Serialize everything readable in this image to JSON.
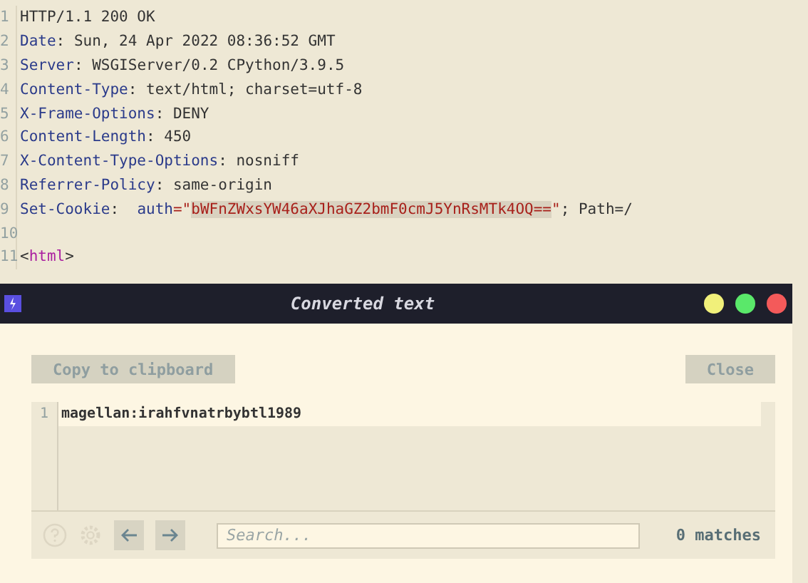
{
  "editor": {
    "lines": [
      {
        "number": "1",
        "segments": [
          {
            "text": "HTTP/1.1 200 OK",
            "kind": "plain"
          }
        ]
      },
      {
        "number": "2",
        "segments": [
          {
            "text": "Date",
            "kind": "key"
          },
          {
            "text": ": Sun, 24 Apr 2022 08:36:52 GMT",
            "kind": "plain"
          }
        ]
      },
      {
        "number": "3",
        "segments": [
          {
            "text": "Server",
            "kind": "key"
          },
          {
            "text": ": WSGIServer/0.2 CPython/3.9.5",
            "kind": "plain"
          }
        ]
      },
      {
        "number": "4",
        "segments": [
          {
            "text": "Content-Type",
            "kind": "key"
          },
          {
            "text": ": text/html; charset=utf-8",
            "kind": "plain"
          }
        ]
      },
      {
        "number": "5",
        "segments": [
          {
            "text": "X-Frame-Options",
            "kind": "key"
          },
          {
            "text": ": DENY",
            "kind": "plain"
          }
        ]
      },
      {
        "number": "6",
        "segments": [
          {
            "text": "Content-Length",
            "kind": "key"
          },
          {
            "text": ": 450",
            "kind": "plain"
          }
        ]
      },
      {
        "number": "7",
        "segments": [
          {
            "text": "X-Content-Type-Options",
            "kind": "key"
          },
          {
            "text": ": nosniff",
            "kind": "plain"
          }
        ]
      },
      {
        "number": "8",
        "segments": [
          {
            "text": "Referrer-Policy",
            "kind": "key"
          },
          {
            "text": ": same-origin",
            "kind": "plain"
          }
        ]
      },
      {
        "number": "9",
        "segments": [
          {
            "text": "Set-Cookie",
            "kind": "key"
          },
          {
            "text": ":  ",
            "kind": "plain"
          },
          {
            "text": "auth",
            "kind": "key"
          },
          {
            "text": "=\"",
            "kind": "string"
          },
          {
            "text": "bWFnZWxsYW46aXJhaGZ2bmF0cmJ5YnRsMTk4OQ==",
            "kind": "selected-string"
          },
          {
            "text": "\"",
            "kind": "string"
          },
          {
            "text": "; Path=/",
            "kind": "plain"
          }
        ]
      },
      {
        "number": "10"
      },
      {
        "number": "11",
        "segments": [
          {
            "text": "<",
            "kind": "plain"
          },
          {
            "text": "html",
            "kind": "tag"
          },
          {
            "text": ">",
            "kind": "plain"
          }
        ]
      }
    ]
  },
  "dialog": {
    "title": "Converted text",
    "copy_button": "Copy to clipboard",
    "close_button": "Close",
    "output_lines": [
      {
        "number": "1",
        "text": "magellan:irahfvnatrbybtl1989"
      }
    ],
    "search": {
      "placeholder": "Search...",
      "matches": "0 matches"
    }
  }
}
